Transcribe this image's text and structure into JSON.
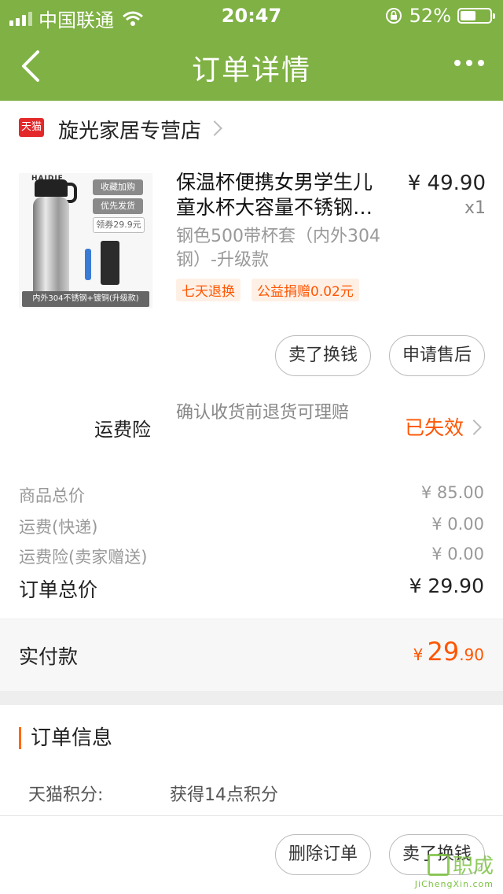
{
  "status_bar": {
    "carrier": "中国联通",
    "time": "20:47",
    "battery": "52%",
    "battery_level": 0.52
  },
  "nav": {
    "title": "订单详情",
    "back_icon": "chevron-left-icon",
    "more_icon": "more-dots-icon"
  },
  "store": {
    "badge": "天猫",
    "name": "旋光家居专营店"
  },
  "product": {
    "title_line1": "保温杯便携女男学生儿",
    "title_line2": "童水杯大容量不锈钢…",
    "price": "¥ 49.90",
    "qty": "x1",
    "sku": "钢色500带杯套（内外304钢）-升级款",
    "badges": [
      "七天退换",
      "公益捐赠0.02元"
    ],
    "image": {
      "brand": "HAIDIE",
      "tags": [
        "收藏加购",
        "优先发货",
        "领券29.9元"
      ],
      "caption": "内外304不锈钢+镀铜(升级款)"
    }
  },
  "actions_top": {
    "sell": "卖了换钱",
    "after_sale": "申请售后"
  },
  "insurance": {
    "label": "运费险",
    "desc": "确认收货前退货可理赔",
    "status": "已失效"
  },
  "summary": {
    "rows": [
      {
        "label": "商品总价",
        "value": "¥ 85.00"
      },
      {
        "label": "运费(快递)",
        "value": "¥ 0.00"
      },
      {
        "label": "运费险(卖家赠送)",
        "value": "¥ 0.00"
      }
    ],
    "total_label": "订单总价",
    "total_value": "¥ 29.90"
  },
  "paid": {
    "label": "实付款",
    "currency": "¥",
    "int": "29",
    "dec": ".90"
  },
  "order_info": {
    "title": "订单信息",
    "points_label": "天猫积分:",
    "points_value": "获得14点积分"
  },
  "actions_bottom": {
    "delete": "删除订单",
    "sell": "卖了换钱"
  },
  "watermark": {
    "text": "职成",
    "sub": "JiChengXin.com"
  },
  "colors": {
    "header": "#7fb144",
    "accent": "#ff5500",
    "tmall": "#e4292b"
  }
}
